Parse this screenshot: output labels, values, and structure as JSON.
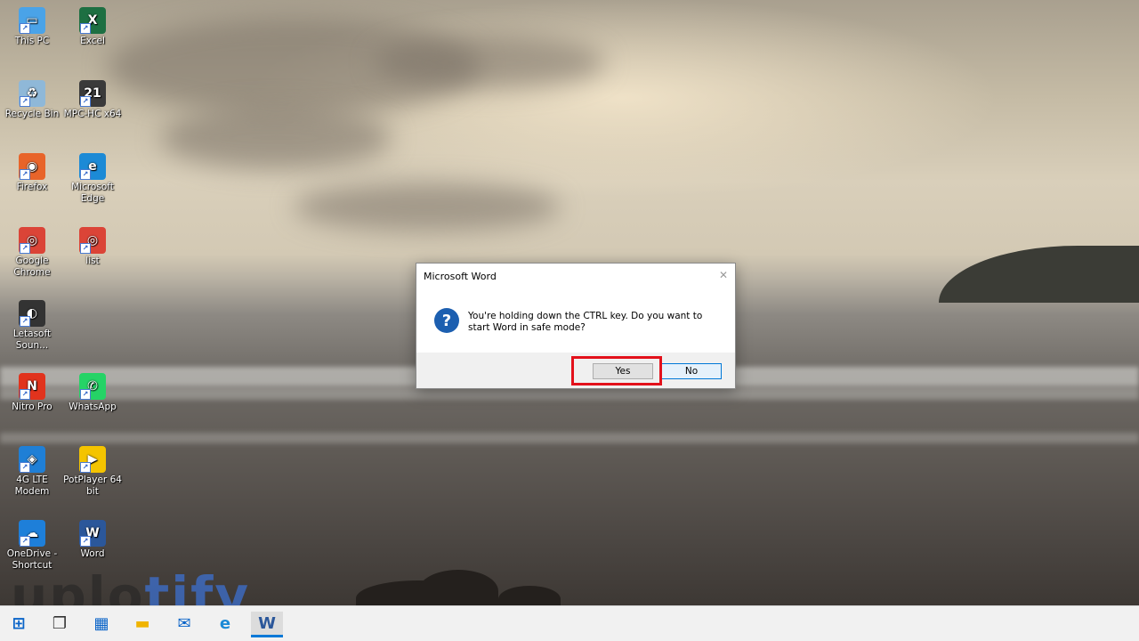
{
  "desktop": {
    "icons": [
      {
        "label": "This PC",
        "symbol": "▭",
        "color": "#4aa3e8"
      },
      {
        "label": "Excel",
        "symbol": "X",
        "color": "#1d6f42"
      },
      {
        "label": "Recycle Bin",
        "symbol": "♻",
        "color": "#8fb8d8"
      },
      {
        "label": "MPC-HC x64",
        "symbol": "21",
        "color": "#3a3a3a"
      },
      {
        "label": "Firefox",
        "symbol": "◉",
        "color": "#e8642a"
      },
      {
        "label": "Microsoft Edge",
        "symbol": "e",
        "color": "#1c8ad6"
      },
      {
        "label": "Google Chrome",
        "symbol": "◎",
        "color": "#db4437"
      },
      {
        "label": "list",
        "symbol": "◎",
        "color": "#db4437"
      },
      {
        "label": "Letasoft Soun...",
        "symbol": "◐",
        "color": "#333333"
      },
      {
        "label": "Nitro Pro",
        "symbol": "N",
        "color": "#e1331d"
      },
      {
        "label": "WhatsApp",
        "symbol": "✆",
        "color": "#25d366"
      },
      {
        "label": "4G LTE Modem",
        "symbol": "◈",
        "color": "#1f7fd6"
      },
      {
        "label": "PotPlayer 64 bit",
        "symbol": "▶",
        "color": "#f4c400"
      },
      {
        "label": "OneDrive - Shortcut",
        "symbol": "☁",
        "color": "#1e7fd9"
      },
      {
        "label": "Word",
        "symbol": "W",
        "color": "#2b579a"
      }
    ]
  },
  "dialog": {
    "title": "Microsoft Word",
    "close_symbol": "✕",
    "icon_symbol": "?",
    "message": "You're holding down the CTRL key. Do you want to start Word in safe mode?",
    "yes_label": "Yes",
    "no_label": "No"
  },
  "watermark": {
    "part1": "uplo",
    "part2": "tify"
  },
  "taskbar": {
    "items": [
      {
        "name": "start-icon",
        "symbol": "⊞",
        "color": "#0a64c8"
      },
      {
        "name": "task-view-icon",
        "symbol": "❐",
        "color": "#333333"
      },
      {
        "name": "microsoft-store-icon",
        "symbol": "▦",
        "color": "#0a64c8"
      },
      {
        "name": "file-explorer-icon",
        "symbol": "▬",
        "color": "#f0b400"
      },
      {
        "name": "mail-icon",
        "symbol": "✉",
        "color": "#0a64c8"
      },
      {
        "name": "edge-taskbar-icon",
        "symbol": "e",
        "color": "#1c8ad6"
      },
      {
        "name": "word-taskbar-icon",
        "symbol": "W",
        "color": "#2b579a"
      }
    ]
  }
}
